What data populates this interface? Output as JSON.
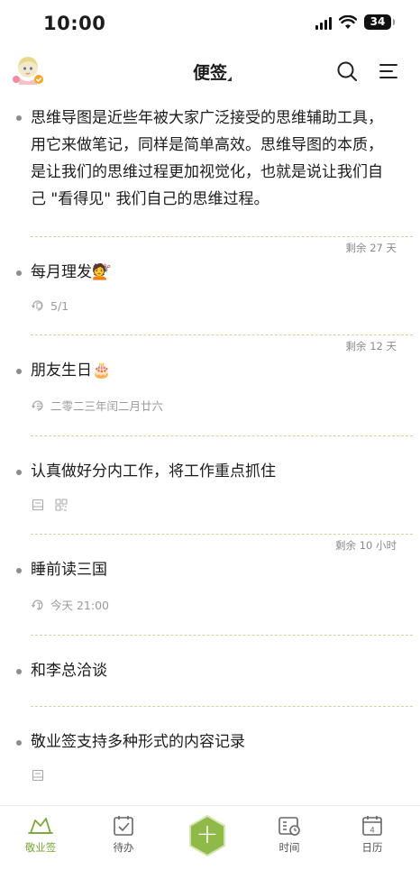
{
  "status_bar": {
    "time": "10:00",
    "battery": "34"
  },
  "header": {
    "title": "便签"
  },
  "notes": [
    {
      "text": "思维导图是近些年被大家广泛接受的思维辅助工具，用它来做笔记，同样是简单高效。思维导图的本质，是让我们的思维过程更加视觉化，也就是说让我们自己 \"看得见\" 我们自己的思维过程。"
    },
    {
      "remaining": "剩余 27 天",
      "text": "每月理发💇",
      "meta": "5/1"
    },
    {
      "remaining": "剩余 12 天",
      "text": "朋友生日🎂",
      "meta": "二零二三年闰二月廿六"
    },
    {
      "text": "认真做好分内工作，将工作重点抓住"
    },
    {
      "remaining": "剩余 10 小时",
      "text": "睡前读三国",
      "meta": "今天 21:00"
    },
    {
      "text": "和李总洽谈"
    },
    {
      "text": "敬业签支持多种形式的内容记录"
    }
  ],
  "tabbar": {
    "items": [
      {
        "label": "敬业签"
      },
      {
        "label": "待办"
      },
      {
        "label": "时间"
      },
      {
        "label": "日历"
      }
    ],
    "calendar_day": "4"
  },
  "colors": {
    "accent": "#7aa636",
    "divider": "#c9d79a",
    "meta_text": "#9a9a9a"
  }
}
